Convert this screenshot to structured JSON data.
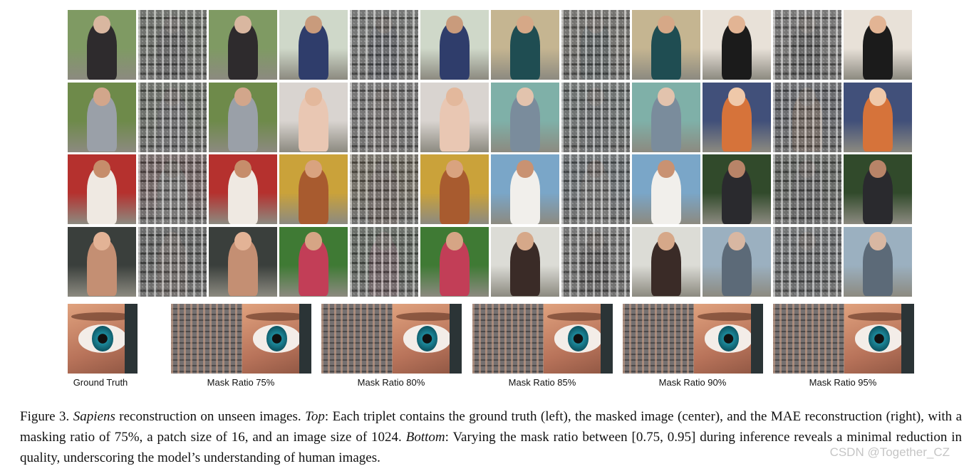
{
  "bottom_labels": [
    "Ground Truth",
    "Mask Ratio 75%",
    "Mask Ratio 80%",
    "Mask Ratio 85%",
    "Mask Ratio 90%",
    "Mask Ratio 95%"
  ],
  "caption": {
    "prefix": "Figure 3. ",
    "model": "Sapiens",
    "part1": " reconstruction on unseen images. ",
    "top": "Top",
    "part2": ": Each triplet contains the ground truth (left), the masked image (center), and the MAE reconstruction (right), with a masking ratio of 75%, a patch size of 16, and an image size of 1024. ",
    "bottom": "Bottom",
    "part3": ": Varying the mask ratio between [0.75, 0.95] during inference reveals a minimal reduction in quality, underscoring the model’s understanding of human images."
  },
  "watermark": "CSDN @Together_CZ",
  "palettes": [
    [
      "#7f9a63",
      "#2e2b2d",
      "#d9b7a0"
    ],
    [
      "#cfd8c9",
      "#2f3d6b",
      "#c99b7c"
    ],
    [
      "#c5b591",
      "#1f4d52",
      "#d6a887"
    ],
    [
      "#e8e1d8",
      "#1b1b1b",
      "#e2b494"
    ],
    [
      "#6e8a4a",
      "#9aa0a8",
      "#d2a68b"
    ],
    [
      "#d9d4d0",
      "#e9c7b3",
      "#e3b89c"
    ],
    [
      "#7fb0a8",
      "#7a8c9c",
      "#e2c3ad"
    ],
    [
      "#41507a",
      "#d6733a",
      "#efc8a9"
    ],
    [
      "#b5312e",
      "#efe9e2",
      "#c68d6b"
    ],
    [
      "#caa23a",
      "#a85b2f",
      "#d9a37f"
    ],
    [
      "#7aa6c8",
      "#f1efeb",
      "#c99272"
    ],
    [
      "#314a2b",
      "#2a2a2e",
      "#b88468"
    ],
    [
      "#3a3f3c",
      "#c48f73",
      "#e3b396"
    ],
    [
      "#3f7a34",
      "#c23e57",
      "#d6a585"
    ],
    [
      "#dcdcd6",
      "#3a2b27",
      "#d6a889"
    ],
    [
      "#9bb0c0",
      "#5c6a78",
      "#d8b7a2"
    ]
  ]
}
